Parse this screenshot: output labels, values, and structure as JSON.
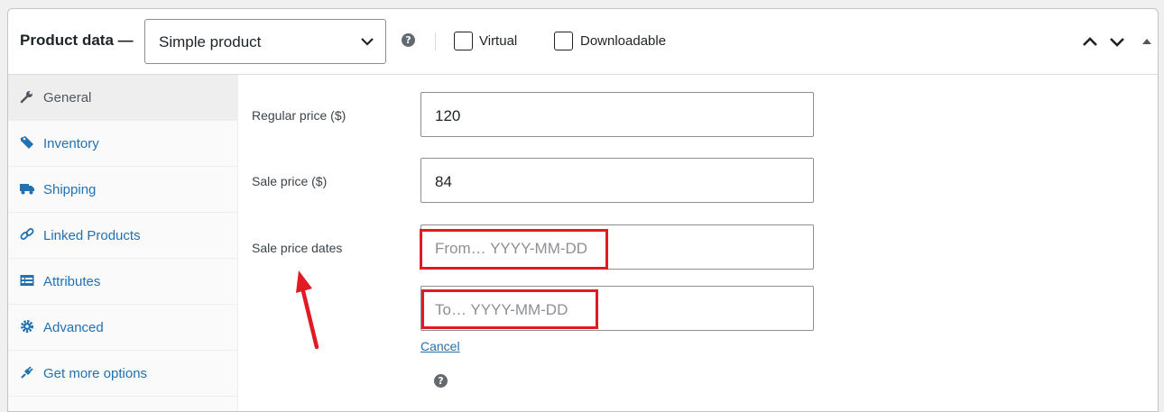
{
  "header": {
    "title": "Product data —",
    "product_type": "Simple product",
    "virtual_label": "Virtual",
    "downloadable_label": "Downloadable"
  },
  "tabs": [
    {
      "label": "General",
      "icon": "wrench-icon",
      "active": true
    },
    {
      "label": "Inventory",
      "icon": "tag-icon",
      "active": false
    },
    {
      "label": "Shipping",
      "icon": "truck-icon",
      "active": false
    },
    {
      "label": "Linked Products",
      "icon": "link-icon",
      "active": false
    },
    {
      "label": "Attributes",
      "icon": "list-icon",
      "active": false
    },
    {
      "label": "Advanced",
      "icon": "gear-icon",
      "active": false
    },
    {
      "label": "Get more options",
      "icon": "plugin-icon",
      "active": false
    }
  ],
  "general": {
    "regular_price_label": "Regular price ($)",
    "regular_price_value": "120",
    "sale_price_label": "Sale price ($)",
    "sale_price_value": "84",
    "sale_dates_label": "Sale price dates",
    "from_placeholder": "From… YYYY-MM-DD",
    "to_placeholder": "To…  YYYY-MM-DD",
    "cancel_label": "Cancel"
  },
  "colors": {
    "link": "#2271b1",
    "annotation": "#e01b24"
  }
}
